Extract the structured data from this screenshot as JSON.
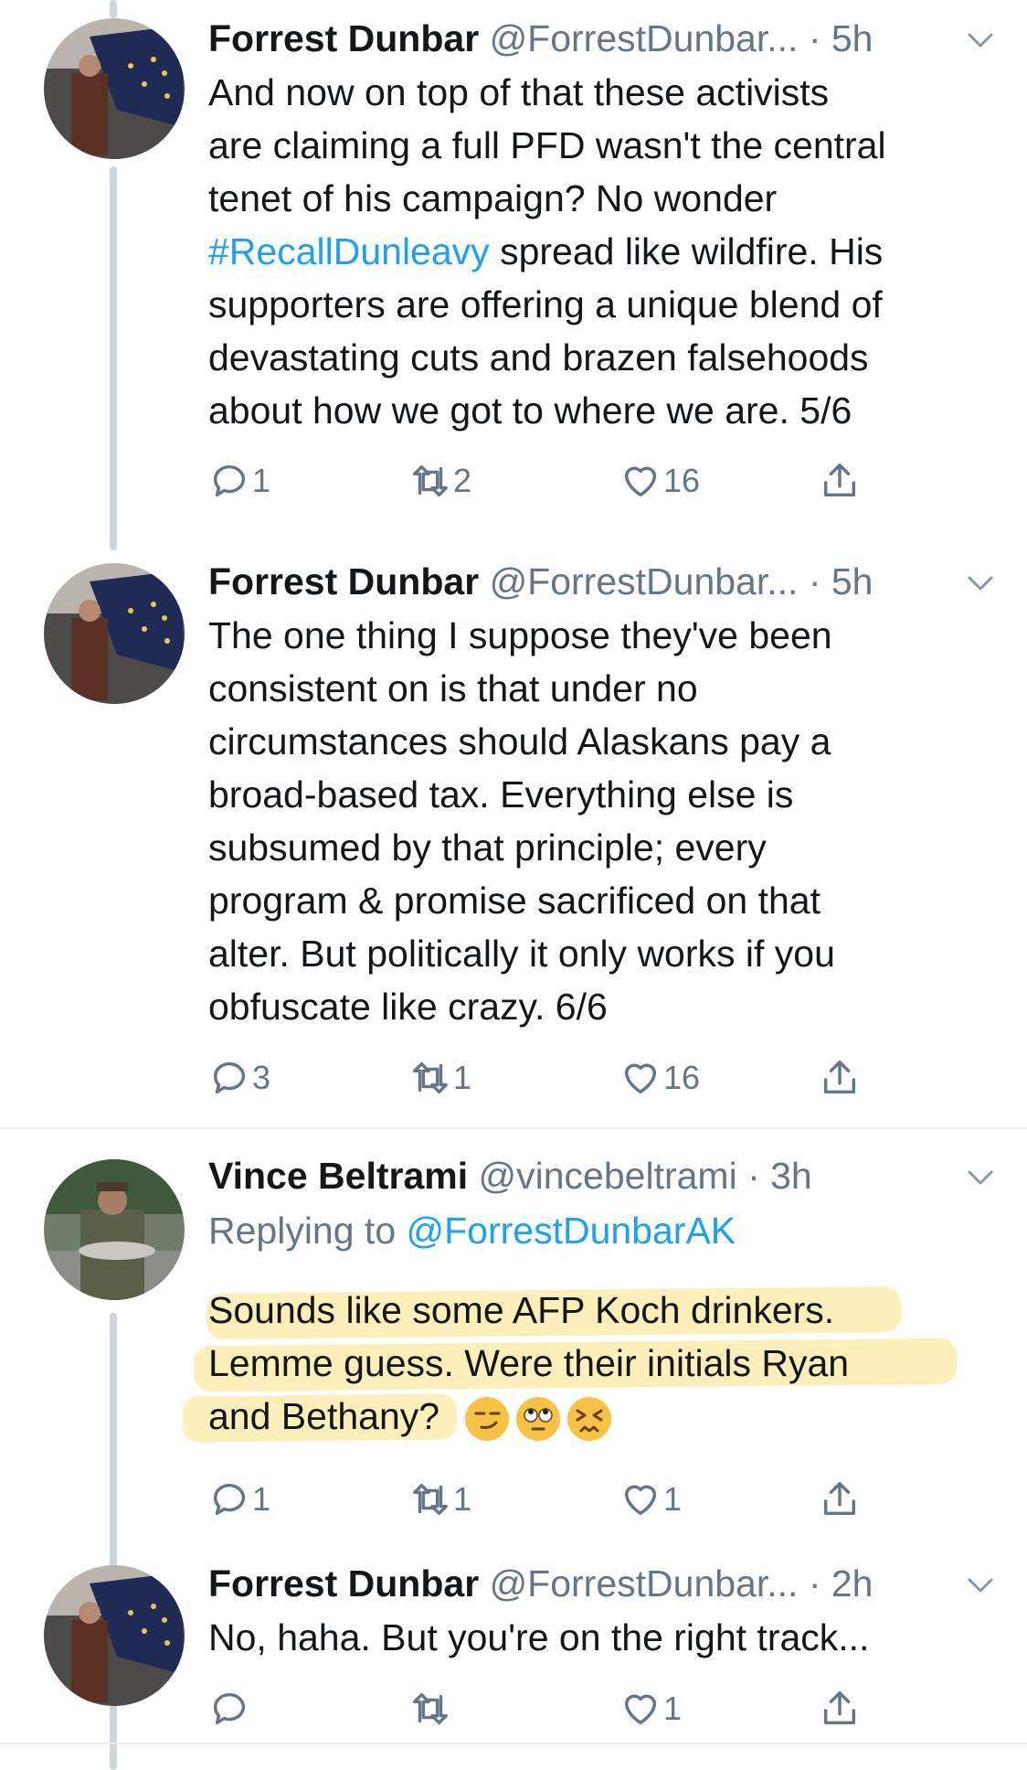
{
  "tweets": [
    {
      "name": "Forrest Dunbar",
      "handle": "@ForrestDunbar...",
      "time": "· 5h",
      "text_before": "And now on top of that these activists\nare claiming a full PFD wasn't the central\ntenet of his campaign? No wonder\n",
      "hashtag": "#RecallDunleavy",
      "text_after": " spread like wildfire. His\nsupporters are offering a unique blend of\ndevastating cuts and brazen falsehoods\nabout how we got to where we are. 5/6",
      "reply_count": "1",
      "retweet_count": "2",
      "like_count": "16"
    },
    {
      "name": "Forrest Dunbar",
      "handle": "@ForrestDunbar...",
      "time": "· 5h",
      "text": "The one thing I suppose they've been\nconsistent on is that under no\ncircumstances should Alaskans pay a\nbroad-based tax. Everything else is\nsubsumed by that principle; every\nprogram & promise sacrificed on that\nalter. But politically it only works if you\nobfuscate like crazy. 6/6",
      "reply_count": "3",
      "retweet_count": "1",
      "like_count": "16"
    },
    {
      "name": "Vince Beltrami",
      "handle": "@vincebeltrami",
      "time": "· 3h",
      "replying_prefix": "Replying to ",
      "replying_to": "@ForrestDunbarAK",
      "text": "Sounds like some AFP Koch drinkers.\nLemme guess. Were their initials Ryan\nand Bethany?",
      "reply_count": "1",
      "retweet_count": "1",
      "like_count": "1"
    },
    {
      "name": "Forrest Dunbar",
      "handle": "@ForrestDunbar...",
      "time": "· 2h",
      "text": "No, haha. But you're on the right track...",
      "reply_count": "",
      "retweet_count": "",
      "like_count": "1"
    }
  ],
  "icons": {
    "reply": "reply-icon",
    "retweet": "retweet-icon",
    "like": "heart-icon",
    "share": "share-icon",
    "caret": "chevron-down-icon",
    "emojis": [
      "smirking-face-icon",
      "eye-roll-face-icon",
      "confounded-face-icon"
    ]
  },
  "colors": {
    "link": "#1da1f2",
    "secondary": "#657786",
    "thread_line": "#ccd6dd",
    "highlight": "#fae182"
  }
}
